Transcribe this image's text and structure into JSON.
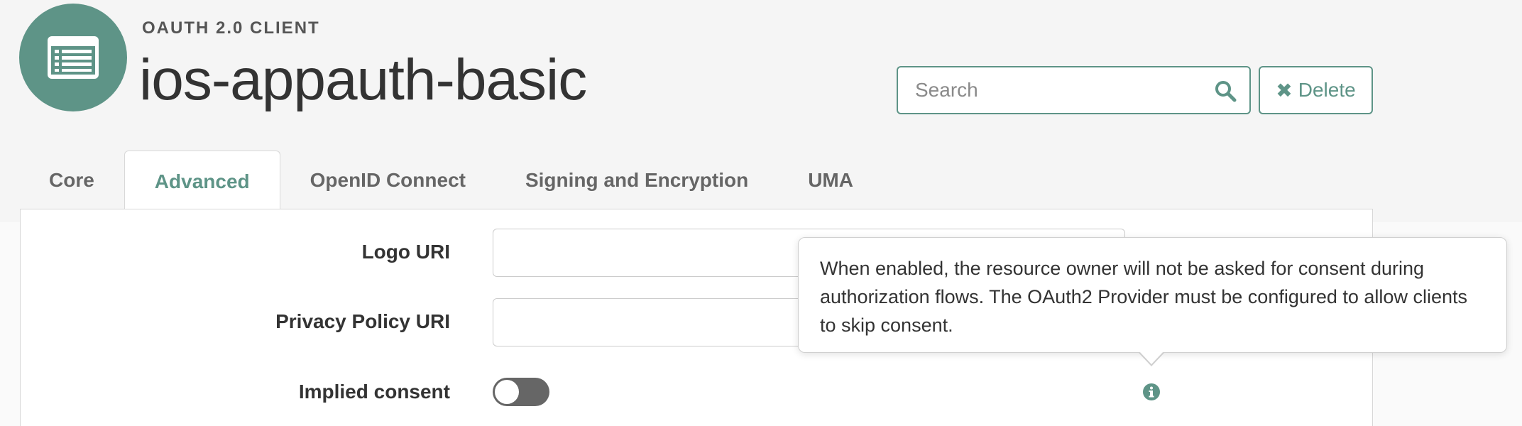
{
  "header": {
    "subtitle": "OAUTH 2.0 CLIENT",
    "title": "ios-appauth-basic",
    "avatar_icon": "list-window-icon"
  },
  "search": {
    "placeholder": "Search",
    "value": ""
  },
  "actions": {
    "delete_label": "Delete"
  },
  "tabs": [
    {
      "label": "Core",
      "active": false
    },
    {
      "label": "Advanced",
      "active": true
    },
    {
      "label": "OpenID Connect",
      "active": false
    },
    {
      "label": "Signing and Encryption",
      "active": false
    },
    {
      "label": "UMA",
      "active": false
    }
  ],
  "form": {
    "fields": [
      {
        "label": "Logo URI",
        "value": ""
      },
      {
        "label": "Privacy Policy URI",
        "value": ""
      }
    ],
    "implied_consent": {
      "label": "Implied consent",
      "enabled": false
    }
  },
  "tooltip": {
    "text": "When enabled, the resource owner will not be asked for consent during authorization flows. The OAuth2 Provider must be configured to allow clients to skip consent."
  },
  "colors": {
    "accent": "#5e9487",
    "toggle_off": "#666666",
    "background": "#f5f5f5"
  }
}
